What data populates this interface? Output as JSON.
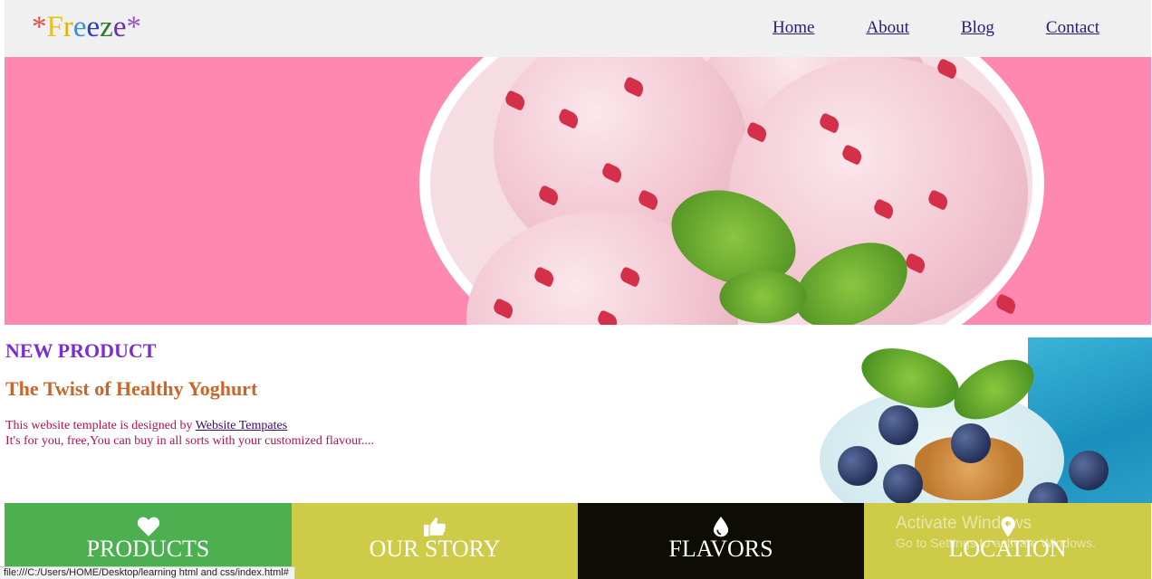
{
  "header": {
    "logo": {
      "chars": [
        "*",
        "F",
        "r",
        "e",
        "e",
        "z",
        "e",
        "*"
      ],
      "colors": [
        "#e8473a",
        "#f2c200",
        "#e0b400",
        "#3a8ee0",
        "#2a3fbf",
        "#2a7a2a",
        "#6a2fb0",
        "#9a4fd0"
      ]
    },
    "nav": [
      {
        "label": "Home"
      },
      {
        "label": "About"
      },
      {
        "label": "Blog"
      },
      {
        "label": "Contact"
      }
    ]
  },
  "hero": {
    "image": "strawberry-ice-cream-bowl"
  },
  "new_product": {
    "title": "NEW PRODUCT",
    "subtitle": "The Twist of Healthy Yoghurt",
    "line1_prefix": "This website template is designed by ",
    "line1_link": "Website Tempates",
    "line2": "It's for you, free,You can buy in all sorts with your customized flavour....",
    "image": "blueberry-yoghurt-glass"
  },
  "tiles": [
    {
      "label": "PRODUCTS",
      "icon": "heart-icon",
      "color": "#4caf50"
    },
    {
      "label": "OUR STORY",
      "icon": "thumbs-up-icon",
      "color": "#cdcb48"
    },
    {
      "label": "FLAVORS",
      "icon": "drop-icon",
      "color": "#0d0d05"
    },
    {
      "label": "LOCATION",
      "icon": "map-marker-icon",
      "color": "#cdcb48"
    }
  ],
  "watermark": {
    "line1": "Activate Windows",
    "line2": "Go to Settings to activate Windows."
  },
  "status_bar": {
    "url": "file:///C:/Users/HOME/Desktop/learning html and css/index.html#"
  }
}
